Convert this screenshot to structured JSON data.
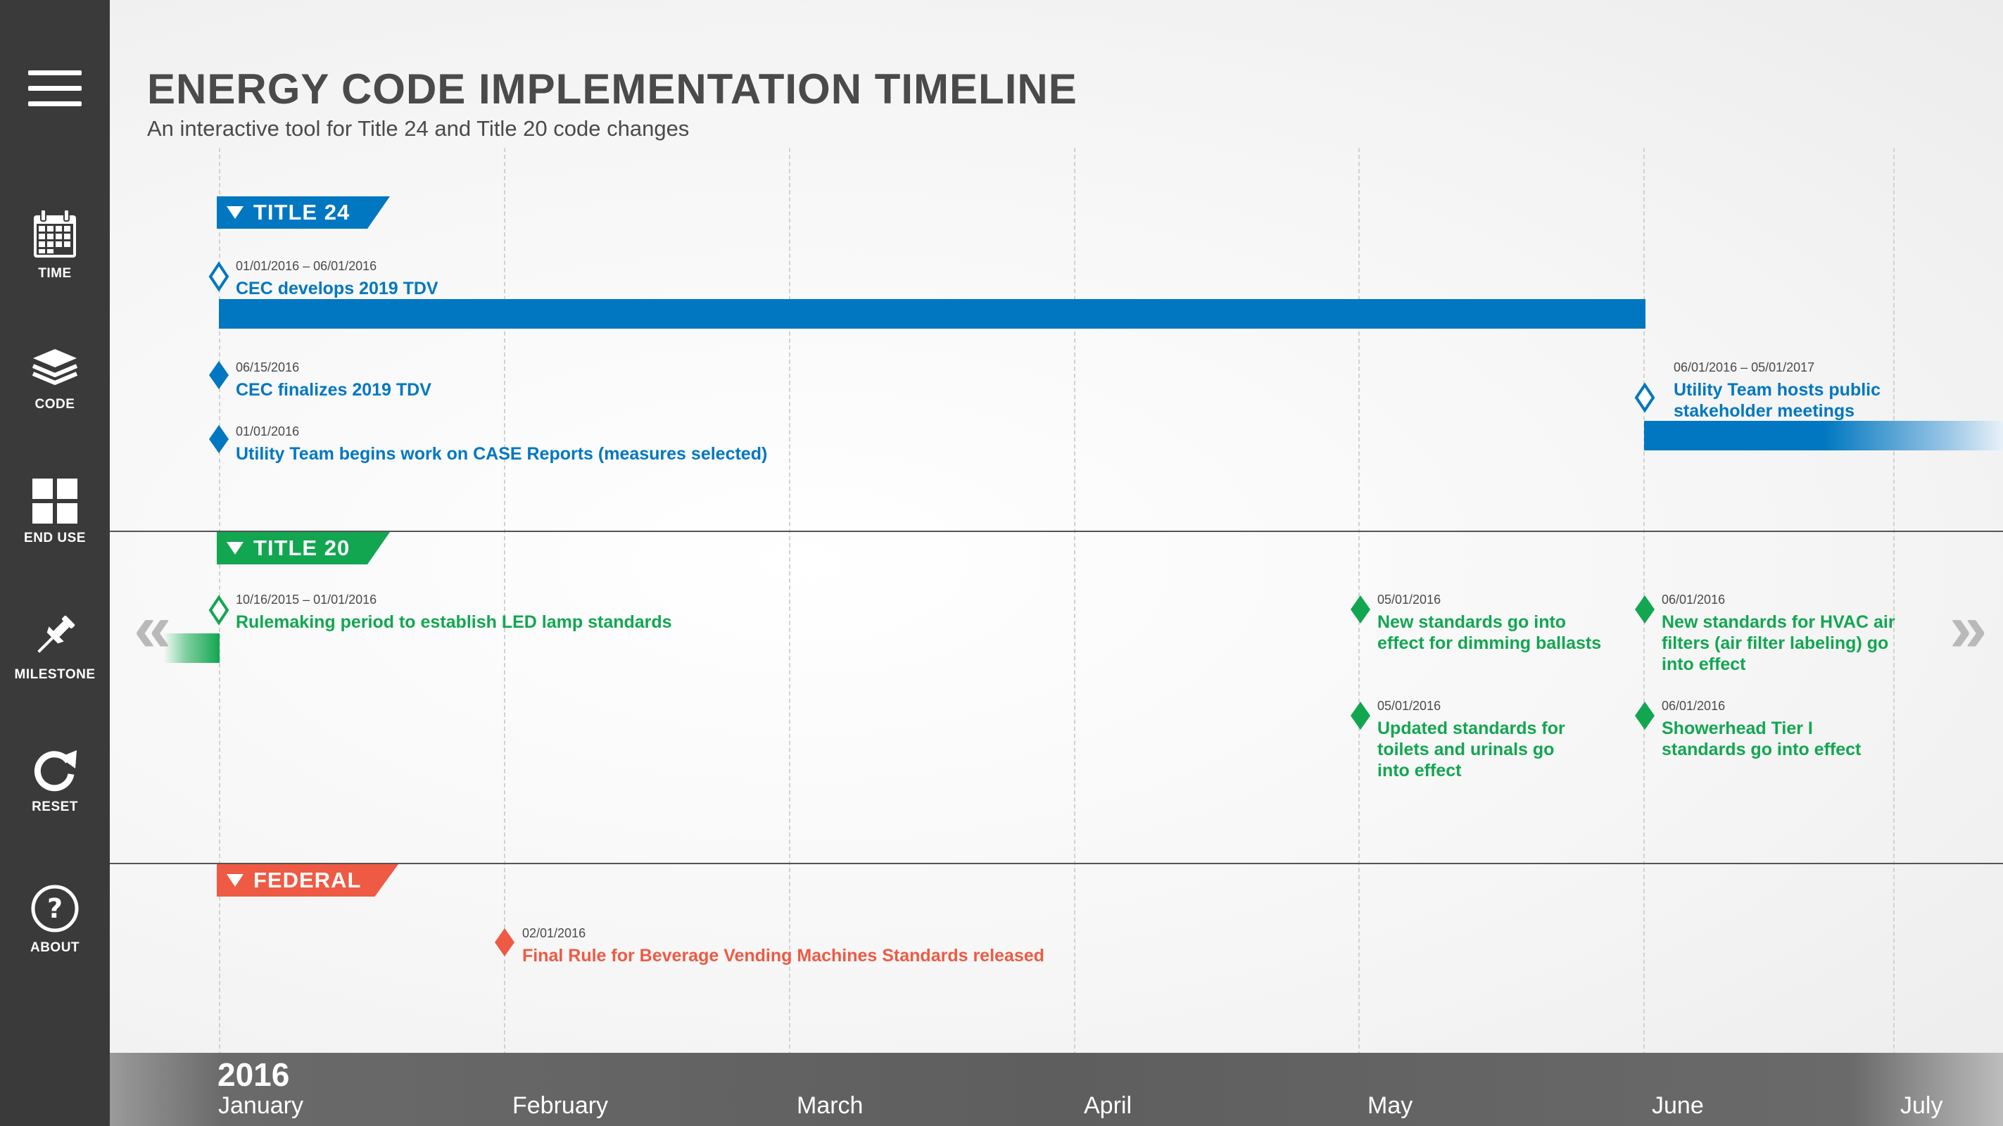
{
  "header": {
    "title": "ENERGY CODE IMPLEMENTATION TIMELINE",
    "subtitle": "An interactive tool for Title 24 and Title 20 code changes"
  },
  "sidebar": {
    "items": [
      {
        "label": "TIME",
        "icon": "calendar-icon"
      },
      {
        "label": "CODE",
        "icon": "layers-icon"
      },
      {
        "label": "END USE",
        "icon": "grid-icon"
      },
      {
        "label": "MILESTONE",
        "icon": "pin-icon"
      },
      {
        "label": "RESET",
        "icon": "refresh-icon"
      },
      {
        "label": "ABOUT",
        "icon": "help-icon"
      }
    ]
  },
  "sections": {
    "title24": {
      "label": "TITLE 24",
      "color": "#0077c0",
      "events": [
        {
          "date": "01/01/2016 – 06/01/2016",
          "name": "CEC develops 2019 TDV"
        },
        {
          "date": "06/15/2016",
          "name": "CEC finalizes 2019 TDV"
        },
        {
          "date": "01/01/2016",
          "name": "Utility Team begins work on CASE Reports (measures selected)"
        },
        {
          "date": "06/01/2016 – 05/01/2017",
          "name_line1": "Utility Team hosts public",
          "name_line2": "stakeholder meetings"
        }
      ]
    },
    "title20": {
      "label": "TITLE 20",
      "color": "#12a651",
      "events": [
        {
          "date": "10/16/2015 – 01/01/2016",
          "name": "Rulemaking period to establish LED lamp standards"
        },
        {
          "date": "05/01/2016",
          "name_line1": "New standards go into",
          "name_line2": "effect for dimming ballasts"
        },
        {
          "date": "06/01/2016",
          "name_line1": "New standards for HVAC air",
          "name_line2": "filters (air filter labeling) go",
          "name_line3": "into effect"
        },
        {
          "date": "05/01/2016",
          "name_line1": "Updated standards for",
          "name_line2": "toilets and urinals go",
          "name_line3": "into effect"
        },
        {
          "date": "06/01/2016",
          "name_line1": "Showerhead Tier I",
          "name_line2": "standards go into effect"
        }
      ]
    },
    "federal": {
      "label": "FEDERAL",
      "color": "#ee5a43",
      "events": [
        {
          "date": "02/01/2016",
          "name": "Final Rule for Beverage Vending Machines Standards released"
        }
      ]
    }
  },
  "navigation": {
    "prev": "«",
    "next": "»"
  },
  "axis": {
    "year": "2016",
    "months": [
      "January",
      "February",
      "March",
      "April",
      "May",
      "June",
      "July"
    ]
  }
}
